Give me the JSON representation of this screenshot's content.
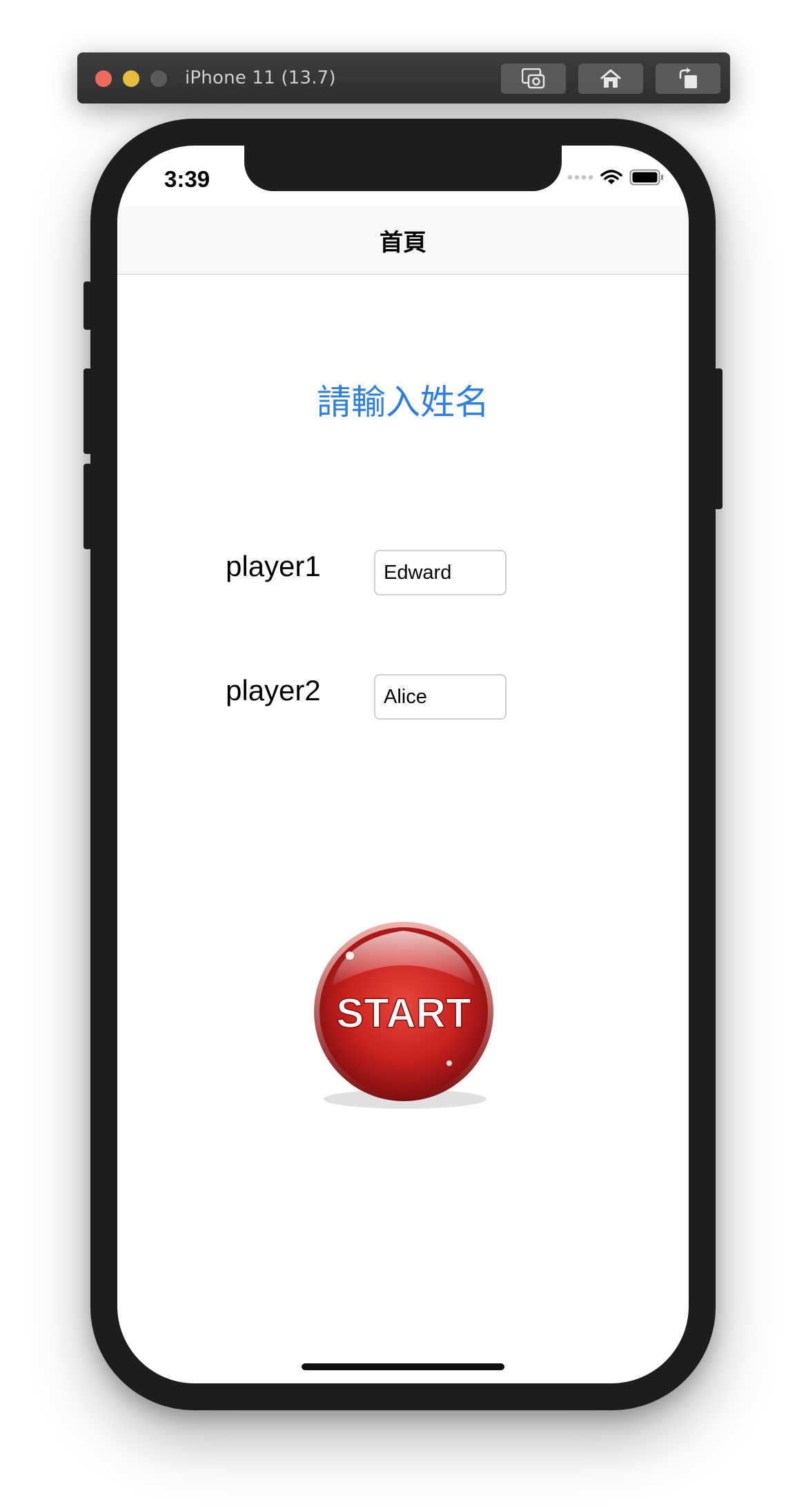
{
  "simulator": {
    "title": "iPhone 11 (13.7)",
    "buttons": [
      {
        "icon": "screenshot-icon"
      },
      {
        "icon": "home-icon"
      },
      {
        "icon": "rotate-icon"
      }
    ]
  },
  "status_bar": {
    "time": "3:39"
  },
  "navbar": {
    "title": "首頁"
  },
  "main": {
    "prompt": "請輸入姓名",
    "players": [
      {
        "label": "player1",
        "value": "Edward"
      },
      {
        "label": "player2",
        "value": "Alice"
      }
    ],
    "start_button": {
      "label": "START"
    }
  },
  "colors": {
    "accent": "#2f7fe0",
    "start_red": "#c9221f"
  }
}
